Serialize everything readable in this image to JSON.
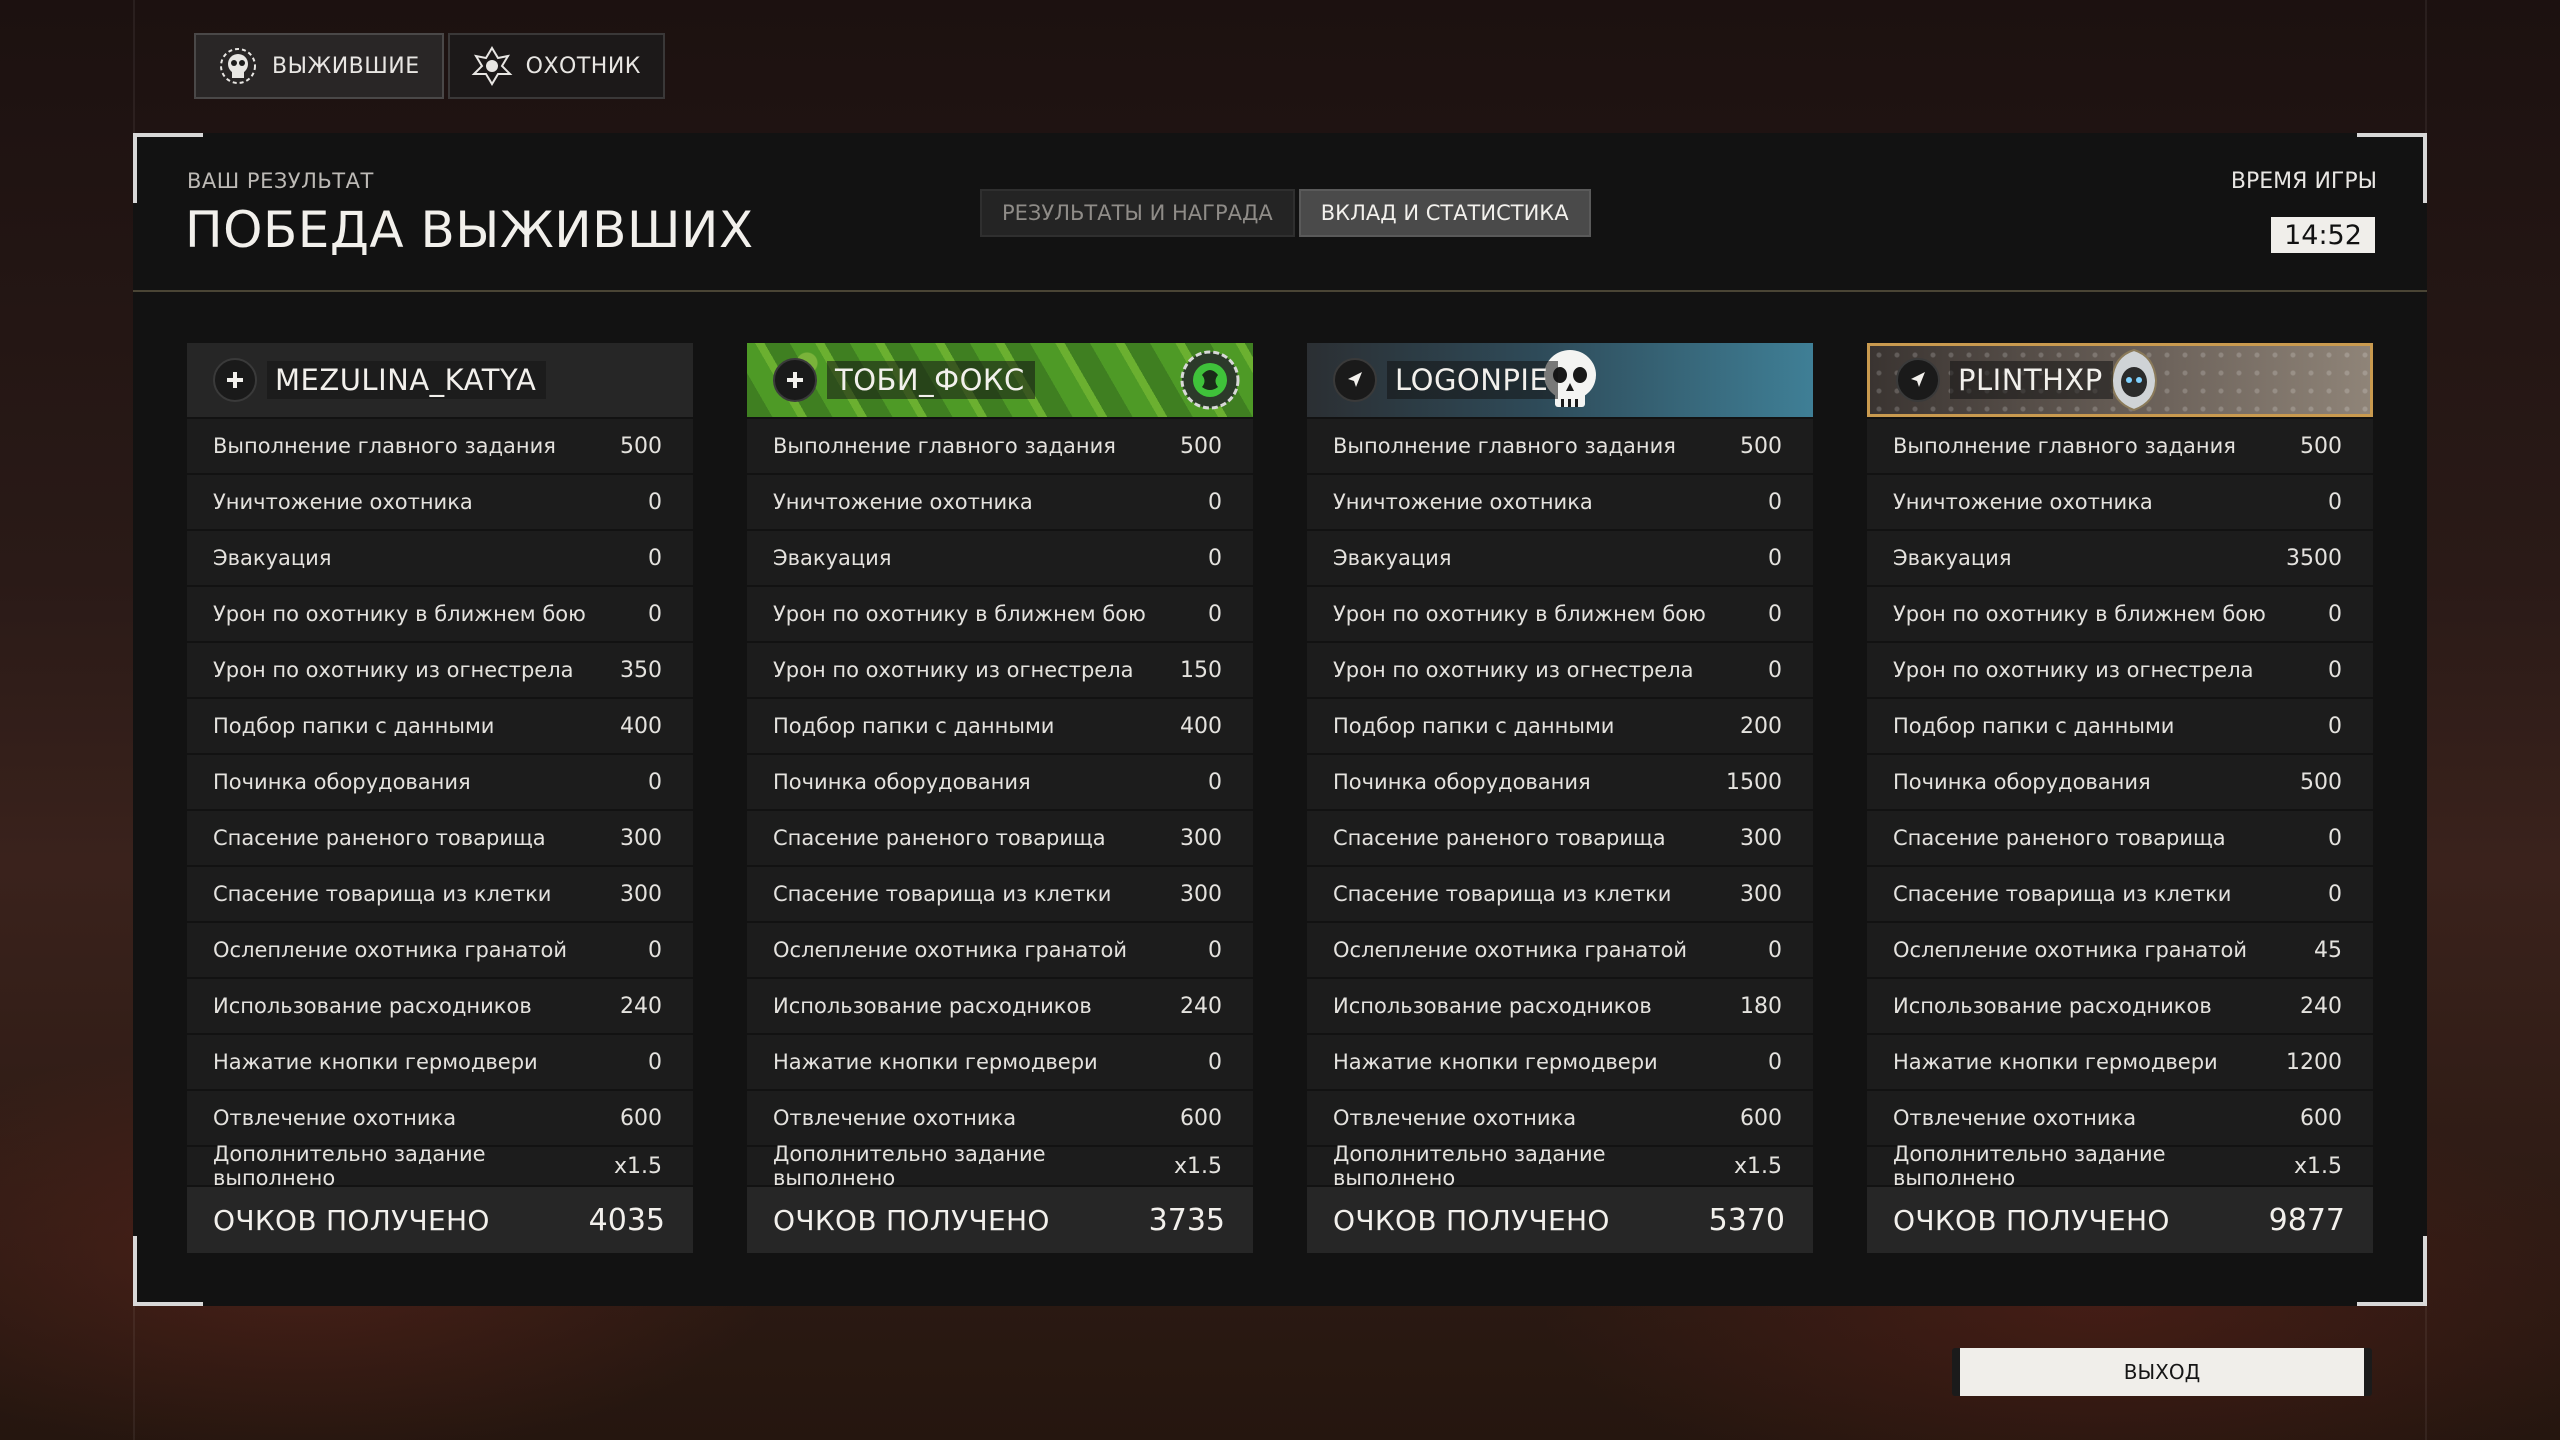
{
  "faction_tabs": [
    {
      "label": "ВЫЖИВШИЕ",
      "icon": "survivor-skull-icon",
      "active": true
    },
    {
      "label": "ОХОТНИК",
      "icon": "hunter-emblem-icon",
      "active": false
    }
  ],
  "result": {
    "label": "ВАШ РЕЗУЛЬТАТ",
    "title": "ПОБЕДА ВЫЖИВШИХ"
  },
  "view_tabs": [
    {
      "label": "РЕЗУЛЬТАТЫ И НАГРАДА",
      "active": false
    },
    {
      "label": "ВКЛАД И СТАТИСТИКА",
      "active": true
    }
  ],
  "game_time": {
    "label": "ВРЕМЯ ИГРЫ",
    "value": "14:52"
  },
  "stat_labels": [
    "Выполнение главного задания",
    "Уничтожение охотника",
    "Эвакуация",
    "Урон по охотнику в ближнем бою",
    "Урон по охотнику из огнестрела",
    "Подбор папки с данными",
    "Починка оборудования",
    "Спасение раненого товарища",
    "Спасение товарища из клетки",
    "Ослепление охотника гранатой",
    "Использование расходников",
    "Нажатие кнопки гермодвери",
    "Отвлечение охотника"
  ],
  "multiplier_label": "Дополнительно задание выполнено",
  "total_label": "ОЧКОВ ПОЛУЧЕНО",
  "players": [
    {
      "name": "MEZULINA_KATYA",
      "role_icon": "medic-plus-icon",
      "values": [
        "500",
        "0",
        "0",
        "0",
        "350",
        "400",
        "0",
        "300",
        "300",
        "0",
        "240",
        "0",
        "600"
      ],
      "multiplier": "x1.5",
      "total": "4035"
    },
    {
      "name": "ТОБИ_ФОКС",
      "role_icon": "medic-plus-icon",
      "values": [
        "500",
        "0",
        "0",
        "0",
        "150",
        "400",
        "0",
        "300",
        "300",
        "0",
        "240",
        "0",
        "600"
      ],
      "multiplier": "x1.5",
      "total": "3735"
    },
    {
      "name": "LOGONPIE",
      "role_icon": "scout-arrow-icon",
      "values": [
        "500",
        "0",
        "0",
        "0",
        "0",
        "200",
        "1500",
        "300",
        "300",
        "0",
        "180",
        "0",
        "600"
      ],
      "multiplier": "x1.5",
      "total": "5370"
    },
    {
      "name": "PLINTHXP",
      "role_icon": "scout-arrow-icon",
      "values": [
        "500",
        "0",
        "3500",
        "0",
        "0",
        "0",
        "500",
        "0",
        "0",
        "45",
        "240",
        "1200",
        "600"
      ],
      "multiplier": "x1.5",
      "total": "9877"
    }
  ],
  "exit_label": "ВЫХОД",
  "colors": {
    "panel": "#121212",
    "row": "#1c1c1c",
    "accent_gold": "#c99a4f",
    "text": "#e8e6e3"
  }
}
